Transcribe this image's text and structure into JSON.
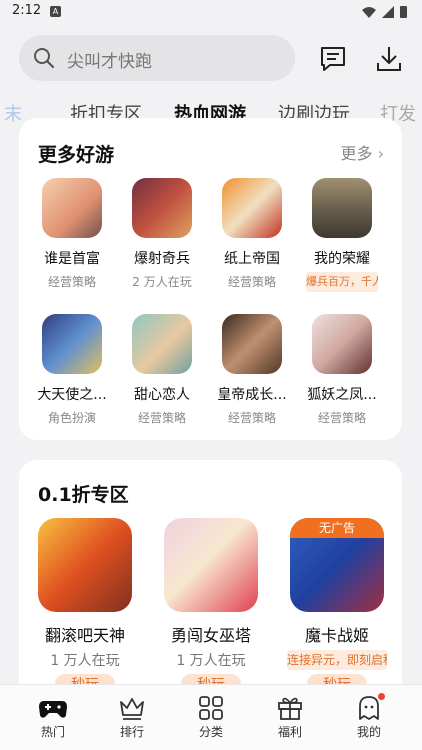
{
  "status": {
    "time": "2:12",
    "notif_icon": "A"
  },
  "search": {
    "placeholder": "尖叫才快跑"
  },
  "tabs": [
    {
      "label": "末"
    },
    {
      "label": "折扣专区"
    },
    {
      "label": "热血网游"
    },
    {
      "label": "边刷边玩"
    },
    {
      "label": "打发"
    }
  ],
  "section1": {
    "title": "更多好游",
    "more": "更多",
    "games": [
      {
        "name": "谁是首富",
        "sub": "经营策略",
        "color": "#f0b890"
      },
      {
        "name": "爆射奇兵",
        "sub": "2 万人在玩",
        "color": "#b04040"
      },
      {
        "name": "纸上帝国",
        "sub": "经营策略",
        "color": "#e07030"
      },
      {
        "name": "我的荣耀",
        "tag": "爆兵百万，千人同屏大战",
        "color": "#706858"
      },
      {
        "name": "大天使之...",
        "sub": "角色扮演",
        "color": "#4070b0"
      },
      {
        "name": "甜心恋人",
        "sub": "经营策略",
        "color": "#70b0a8"
      },
      {
        "name": "皇帝成长...",
        "sub": "经营策略",
        "color": "#705040"
      },
      {
        "name": "狐妖之凤...",
        "sub": "经营策略",
        "color": "#d8b8b0"
      }
    ]
  },
  "section2": {
    "title": "0.1折专区",
    "games": [
      {
        "name": "翻滚吧天神",
        "sub": "1 万人在玩",
        "color": "#e05020",
        "button": "秒玩"
      },
      {
        "name": "勇闯女巫塔",
        "sub": "1 万人在玩",
        "color": "#e04050",
        "button": "秒玩"
      },
      {
        "name": "魔卡战姬",
        "ribbon": "无广告",
        "tag": "连接异元，即刻启程",
        "color": "#3050a0",
        "button": "秒玩"
      }
    ]
  },
  "nav": [
    {
      "label": "热门",
      "icon": "gamepad-icon"
    },
    {
      "label": "排行",
      "icon": "crown-icon"
    },
    {
      "label": "分类",
      "icon": "grid-icon"
    },
    {
      "label": "福利",
      "icon": "gift-icon"
    },
    {
      "label": "我的",
      "icon": "ghost-icon"
    }
  ]
}
